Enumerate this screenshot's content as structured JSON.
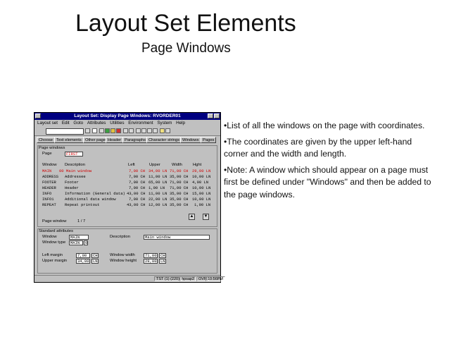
{
  "slide": {
    "title": "Layout Set Elements",
    "subtitle": "Page Windows",
    "bullets": [
      "•List of all the windows on the page with coordinates.",
      "•The coordinates are given by the upper left-hand corner and the width and length.",
      "•Note: A window which should appear on a page must first be defined under \"Windows\" and then be added to the page windows."
    ]
  },
  "sap": {
    "title": "Layout Set: Display Page Windows: RVORDER01",
    "menu": [
      "Layout set",
      "Edit",
      "Goto",
      "Attributes",
      "Utilities",
      "Environment",
      "System",
      "Help"
    ],
    "app_buttons": [
      "Choose",
      "Text elements",
      "Other page",
      "Header",
      "Paragraphs",
      "Character strings",
      "Windows",
      "Pages"
    ],
    "page_windows_label": "Page windows",
    "page_label": "Page",
    "page_value": "FIRST",
    "columns": [
      "Window",
      "Description",
      "Left",
      "Upper",
      "Width",
      "Hght"
    ],
    "rows": [
      {
        "window": "MAIN",
        "description": "00 Main window",
        "left": "7,00 CH",
        "upper": "34,00 LN",
        "width": "71,00 CH",
        "hght": "29,00 LN",
        "highlight": true
      },
      {
        "window": "ADDRESS",
        "description": "Addressee",
        "left": "7,00 CH",
        "upper": "11,00 LN",
        "width": "35,00 CH",
        "hght": "10,00 LN",
        "highlight": false
      },
      {
        "window": "FOOTER",
        "description": "Footer",
        "left": "7,00 CH",
        "upper": "65,00 LN",
        "width": "71,00 CH",
        "hght": "4,00 LN",
        "highlight": false
      },
      {
        "window": "HEADER",
        "description": "Header",
        "left": "7,00 CH",
        "upper": "1,00 LN",
        "width": "71,00 CH",
        "hght": "10,00 LN",
        "highlight": false
      },
      {
        "window": "INFO",
        "description": "Information (General data)",
        "left": "43,00 CH",
        "upper": "11,00 LN",
        "width": "35,00 CH",
        "hght": "15,00 LN",
        "highlight": false
      },
      {
        "window": "INFO1",
        "description": "Additional data window",
        "left": "7,00 CH",
        "upper": "22,00 LN",
        "width": "35,00 CH",
        "hght": "10,00 LN",
        "highlight": false
      },
      {
        "window": "REPEAT",
        "description": "Repeat printout",
        "left": "43,00 CH",
        "upper": "12,00 LN",
        "width": "35,00 CH",
        "hght": "1,00 LN",
        "highlight": false
      }
    ],
    "page_window_label": "Page window",
    "page_window_count": "1  /  7",
    "std_attr_label": "Standard attributes",
    "window_label": "Window",
    "window_value": "MAIN",
    "description_label": "Description",
    "description_value": "Main window",
    "window_type_label": "Window type",
    "window_type_value": "MAIN",
    "window_type_suffix": "0",
    "left_margin_label": "Left margin",
    "left_margin_value": "7,00",
    "left_margin_unit": "CH",
    "upper_margin_label": "Upper margin",
    "upper_margin_value": "34,00",
    "upper_margin_unit": "LN",
    "window_width_label": "Window width",
    "window_width_value": "71,00",
    "window_width_unit": "CH",
    "window_height_label": "Window height",
    "window_height_value": "29,00",
    "window_height_unit": "LN",
    "status": [
      "TST (1) (220)",
      "hpsap2",
      "OVR",
      "10:56PM"
    ]
  }
}
